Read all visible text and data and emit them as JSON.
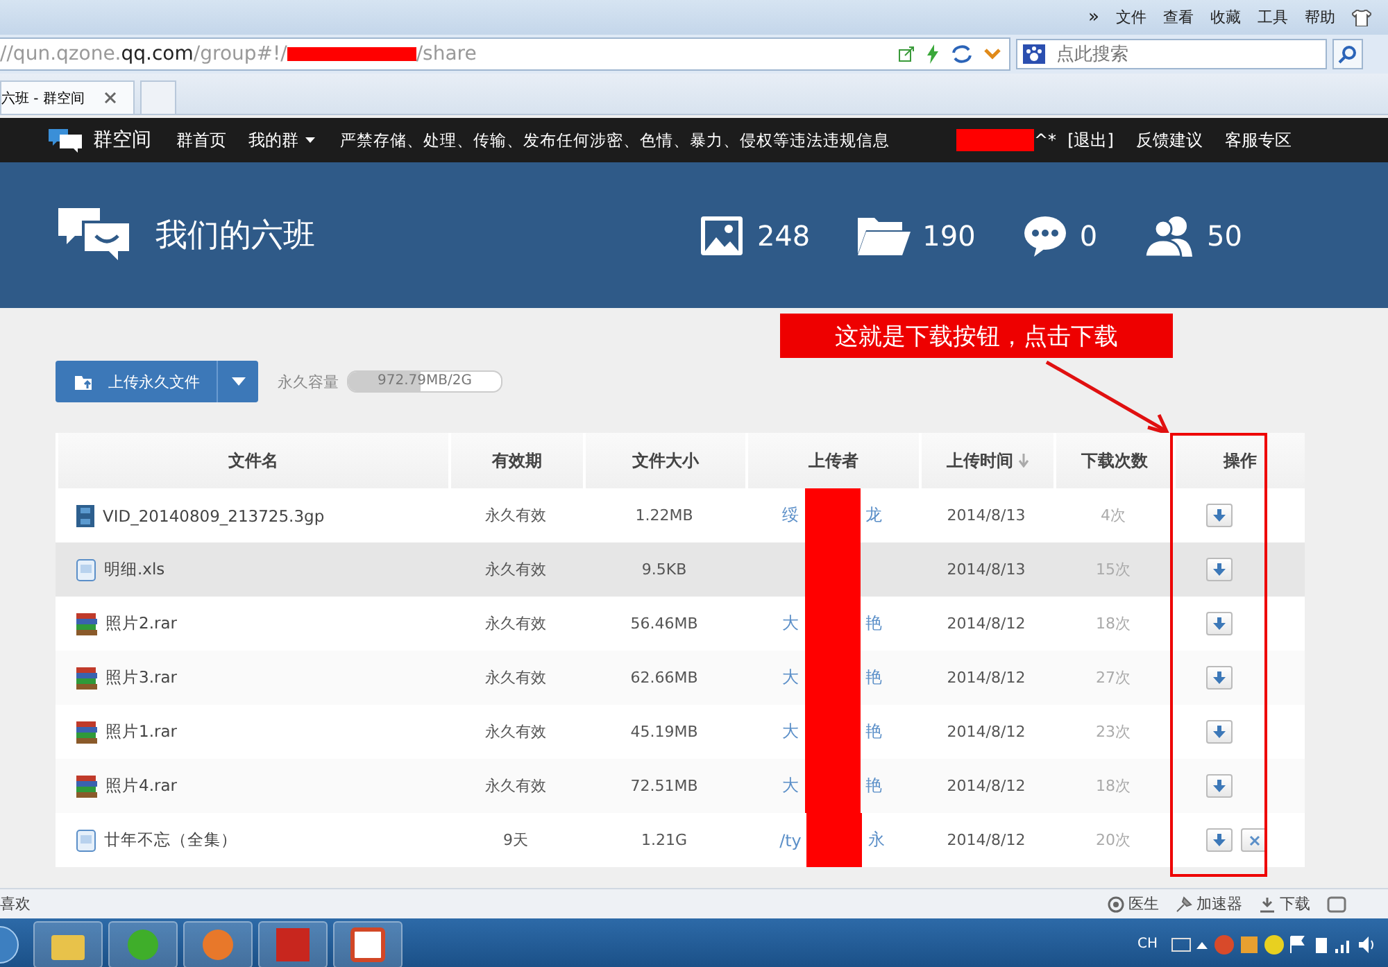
{
  "browser": {
    "more": "»",
    "menu": [
      "文件",
      "查看",
      "收藏",
      "工具",
      "帮助"
    ],
    "address": {
      "prefix": "//qun.qzone.",
      "domain": "qq.com",
      "path_start": "/group#!/",
      "path_end": "/share"
    },
    "search": {
      "placeholder": "点此搜索"
    },
    "tabs": [
      {
        "label": "六班 - 群空间",
        "selected": true
      },
      {
        "selected": false
      }
    ]
  },
  "nav": {
    "brand": "群空间",
    "items": [
      {
        "label": "群首页",
        "dropdown": false
      },
      {
        "label": "我的群",
        "dropdown": true
      }
    ],
    "notice": "严禁存储、处理、传输、发布任何涉密、色情、暴力、侵权等违法违规信息",
    "user_suffix": "^*",
    "links": [
      "[退出]",
      "反馈建议",
      "客服专区"
    ]
  },
  "group": {
    "name": "我们的六班",
    "stats": [
      {
        "kind": "photos",
        "count": "248"
      },
      {
        "kind": "folders",
        "count": "190"
      },
      {
        "kind": "comments",
        "count": "0"
      },
      {
        "kind": "members",
        "count": "50"
      }
    ]
  },
  "upload": {
    "label": "上传永久文件",
    "quota_label": "永久容量",
    "quota": "972.79MB/2G",
    "level": 0.47
  },
  "callout": "这就是下载按钮，点击下载",
  "table": {
    "columns": [
      {
        "label": "文件名",
        "sorted": false
      },
      {
        "label": "有效期",
        "sorted": false
      },
      {
        "label": "文件大小",
        "sorted": false
      },
      {
        "label": "上传者",
        "sorted": false
      },
      {
        "label": "上传时间",
        "sorted": true
      },
      {
        "label": "下载次数",
        "sorted": false
      },
      {
        "label": "操作",
        "sorted": false
      }
    ],
    "rows": [
      {
        "kind": "video",
        "name": "VID_20140809_213725.3gp",
        "validity": "永久有效",
        "size": "1.22MB",
        "uploader_start": "绥",
        "uploader_end": "龙",
        "time": "2014/8/13",
        "downloads": "4次",
        "selected": false,
        "deletable": false
      },
      {
        "kind": "document",
        "name": "明细.xls",
        "validity": "永久有效",
        "size": "9.5KB",
        "time": "2014/8/13",
        "downloads": "15次",
        "selected": true,
        "deletable": false
      },
      {
        "kind": "archive",
        "name": "照片2.rar",
        "validity": "永久有效",
        "size": "56.46MB",
        "uploader_start": "大",
        "uploader_end": "艳",
        "time": "2014/8/12",
        "downloads": "18次",
        "selected": false,
        "deletable": false
      },
      {
        "kind": "archive",
        "name": "照片3.rar",
        "validity": "永久有效",
        "size": "62.66MB",
        "uploader_start": "大",
        "uploader_end": "艳",
        "time": "2014/8/12",
        "downloads": "27次",
        "selected": false,
        "deletable": false
      },
      {
        "kind": "archive",
        "name": "照片1.rar",
        "validity": "永久有效",
        "size": "45.19MB",
        "uploader_start": "大",
        "uploader_end": "艳",
        "time": "2014/8/12",
        "downloads": "23次",
        "selected": false,
        "deletable": false
      },
      {
        "kind": "archive",
        "name": "照片4.rar",
        "validity": "永久有效",
        "size": "72.51MB",
        "uploader_start": "大",
        "uploader_end": "艳",
        "time": "2014/8/12",
        "downloads": "18次",
        "selected": false,
        "deletable": false
      },
      {
        "kind": "document",
        "name": "廿年不忘（全集）",
        "validity": "9天",
        "size": "1.21G",
        "uploader_start": "/ty",
        "uploader_end": "永",
        "time": "2014/8/12",
        "downloads": "20次",
        "selected": false,
        "deletable": true
      }
    ]
  },
  "status_bar": {
    "left": "喜欢",
    "items": [
      {
        "kind": "doctor",
        "label": "医生"
      },
      {
        "kind": "accelerator",
        "label": "加速器"
      },
      {
        "kind": "download",
        "label": "下载"
      }
    ]
  },
  "taskbar": {
    "apps": [
      {
        "kind": "folder"
      },
      {
        "kind": "browser"
      },
      {
        "kind": "fire"
      },
      {
        "kind": "tile"
      },
      {
        "kind": "slides"
      }
    ],
    "language": "CH"
  }
}
